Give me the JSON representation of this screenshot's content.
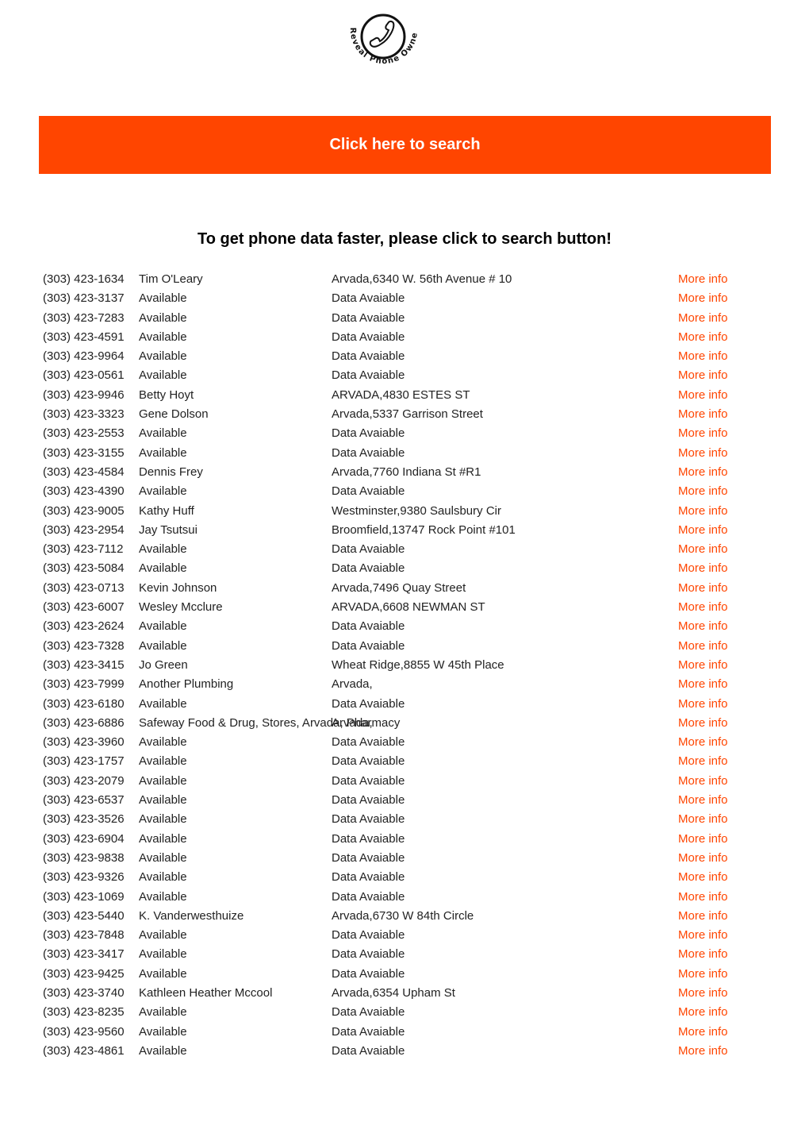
{
  "logo": {
    "icon": "phone-handset-icon",
    "text": "Reveal Phone Owner"
  },
  "banner": {
    "label": "Click here to search",
    "color": "#ff4500"
  },
  "headline": "To get phone data faster, please click to search button!",
  "more_info_color": "#ff4500",
  "rows": [
    {
      "phone": "(303) 423-1634",
      "name": "Tim O'Leary",
      "address": "Arvada,6340 W. 56th Avenue # 10",
      "link": "More info"
    },
    {
      "phone": "(303) 423-3137",
      "name": "Available",
      "address": "Data Avaiable",
      "link": "More info"
    },
    {
      "phone": "(303) 423-7283",
      "name": "Available",
      "address": "Data Avaiable",
      "link": "More info"
    },
    {
      "phone": "(303) 423-4591",
      "name": "Available",
      "address": "Data Avaiable",
      "link": "More info"
    },
    {
      "phone": "(303) 423-9964",
      "name": "Available",
      "address": "Data Avaiable",
      "link": "More info"
    },
    {
      "phone": "(303) 423-0561",
      "name": "Available",
      "address": "Data Avaiable",
      "link": "More info"
    },
    {
      "phone": "(303) 423-9946",
      "name": "Betty Hoyt",
      "address": "ARVADA,4830 ESTES ST",
      "link": "More info"
    },
    {
      "phone": "(303) 423-3323",
      "name": "Gene Dolson",
      "address": "Arvada,5337 Garrison Street",
      "link": "More info"
    },
    {
      "phone": "(303) 423-2553",
      "name": "Available",
      "address": "Data Avaiable",
      "link": "More info"
    },
    {
      "phone": "(303) 423-3155",
      "name": "Available",
      "address": "Data Avaiable",
      "link": "More info"
    },
    {
      "phone": "(303) 423-4584",
      "name": "Dennis  Frey",
      "address": "Arvada,7760 Indiana St #R1",
      "link": "More info"
    },
    {
      "phone": "(303) 423-4390",
      "name": "Available",
      "address": "Data Avaiable",
      "link": "More info"
    },
    {
      "phone": "(303) 423-9005",
      "name": "Kathy Huff",
      "address": "Westminster,9380 Saulsbury Cir",
      "link": "More info"
    },
    {
      "phone": "(303) 423-2954",
      "name": "Jay Tsutsui",
      "address": "Broomfield,13747 Rock Point #101",
      "link": "More info"
    },
    {
      "phone": "(303) 423-7112",
      "name": "Available",
      "address": "Data Avaiable",
      "link": "More info"
    },
    {
      "phone": "(303) 423-5084",
      "name": "Available",
      "address": "Data Avaiable",
      "link": "More info"
    },
    {
      "phone": "(303) 423-0713",
      "name": "Kevin Johnson",
      "address": "Arvada,7496 Quay Street",
      "link": "More info"
    },
    {
      "phone": "(303) 423-6007",
      "name": "Wesley Mcclure",
      "address": "ARVADA,6608 NEWMAN ST",
      "link": "More info"
    },
    {
      "phone": "(303) 423-2624",
      "name": "Available",
      "address": "Data Avaiable",
      "link": "More info"
    },
    {
      "phone": "(303) 423-7328",
      "name": "Available",
      "address": "Data Avaiable",
      "link": "More info"
    },
    {
      "phone": "(303) 423-3415",
      "name": "Jo Green",
      "address": "Wheat Ridge,8855 W 45th Place",
      "link": "More info"
    },
    {
      "phone": "(303) 423-7999",
      "name": "Another Plumbing",
      "address": "Arvada,",
      "link": "More info"
    },
    {
      "phone": "(303) 423-6180",
      "name": "Available",
      "address": "Data Avaiable",
      "link": "More info"
    },
    {
      "phone": "(303) 423-6886",
      "name": "Safeway Food & Drug, Stores, Arvada, Pharmacy",
      "address": "Arvada,",
      "link": "More info"
    },
    {
      "phone": "(303) 423-3960",
      "name": "Available",
      "address": "Data Avaiable",
      "link": "More info"
    },
    {
      "phone": "(303) 423-1757",
      "name": "Available",
      "address": "Data Avaiable",
      "link": "More info"
    },
    {
      "phone": "(303) 423-2079",
      "name": "Available",
      "address": "Data Avaiable",
      "link": "More info"
    },
    {
      "phone": "(303) 423-6537",
      "name": "Available",
      "address": "Data Avaiable",
      "link": "More info"
    },
    {
      "phone": "(303) 423-3526",
      "name": "Available",
      "address": "Data Avaiable",
      "link": "More info"
    },
    {
      "phone": "(303) 423-6904",
      "name": "Available",
      "address": "Data Avaiable",
      "link": "More info"
    },
    {
      "phone": "(303) 423-9838",
      "name": "Available",
      "address": "Data Avaiable",
      "link": "More info"
    },
    {
      "phone": "(303) 423-9326",
      "name": "Available",
      "address": "Data Avaiable",
      "link": "More info"
    },
    {
      "phone": "(303) 423-1069",
      "name": "Available",
      "address": "Data Avaiable",
      "link": "More info"
    },
    {
      "phone": "(303) 423-5440",
      "name": "K. Vanderwesthuize",
      "address": "Arvada,6730 W 84th Circle",
      "link": "More info"
    },
    {
      "phone": "(303) 423-7848",
      "name": "Available",
      "address": "Data Avaiable",
      "link": "More info"
    },
    {
      "phone": "(303) 423-3417",
      "name": "Available",
      "address": "Data Avaiable",
      "link": "More info"
    },
    {
      "phone": "(303) 423-9425",
      "name": "Available",
      "address": "Data Avaiable",
      "link": "More info"
    },
    {
      "phone": "(303) 423-3740",
      "name": "Kathleen Heather Mccool",
      "address": "Arvada,6354 Upham St",
      "link": "More info"
    },
    {
      "phone": "(303) 423-8235",
      "name": "Available",
      "address": "Data Avaiable",
      "link": "More info"
    },
    {
      "phone": "(303) 423-9560",
      "name": "Available",
      "address": "Data Avaiable",
      "link": "More info"
    },
    {
      "phone": "(303) 423-4861",
      "name": "Available",
      "address": "Data Avaiable",
      "link": "More info"
    }
  ]
}
